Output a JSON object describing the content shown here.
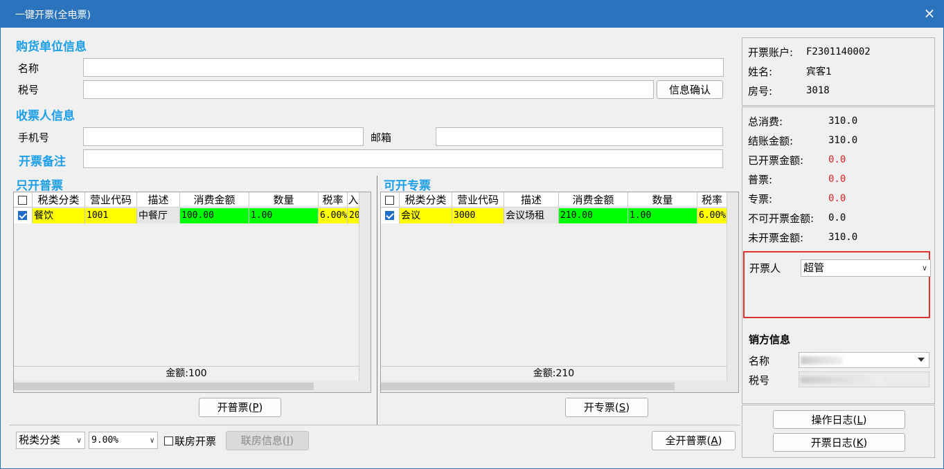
{
  "window": {
    "title": "一键开票(全电票)",
    "close_glyph": "×"
  },
  "buyer": {
    "section_title": "购货单位信息",
    "name_label": "名称",
    "name_value": "",
    "tax_label": "税号",
    "tax_value": "",
    "confirm_button": "信息确认"
  },
  "receiver": {
    "section_title": "收票人信息",
    "phone_label": "手机号",
    "phone_value": "",
    "email_label": "邮箱",
    "email_value": ""
  },
  "remark": {
    "label": "开票备注",
    "value": ""
  },
  "normal_grid": {
    "section_title": "只开普票",
    "columns": [
      "税类分类",
      "营业代码",
      "描述",
      "消费金额",
      "数量",
      "税率",
      "入"
    ],
    "rows": [
      {
        "checked": true,
        "category": "餐饮",
        "code": "1001",
        "desc": "中餐厅",
        "amount": "100.00",
        "qty": "1.00",
        "rate": "6.00%",
        "extra": "20"
      }
    ],
    "total": "金额:100",
    "issue_button": "开普票(P)",
    "issue_button_main": "开普票(",
    "issue_button_key": "P",
    "issue_button_end": ")"
  },
  "special_grid": {
    "section_title": "可开专票",
    "columns": [
      "税类分类",
      "营业代码",
      "描述",
      "消费金额",
      "数量",
      "税率"
    ],
    "rows": [
      {
        "checked": true,
        "category": "会议",
        "code": "3000",
        "desc": "会议场租",
        "amount": "210.00",
        "qty": "1.00",
        "rate": "6.00%"
      }
    ],
    "total": "金额:210",
    "issue_button": "开专票(S)",
    "issue_button_main": "开专票(",
    "issue_button_key": "S",
    "issue_button_end": ")"
  },
  "bottom": {
    "tax_category_select": "税类分类",
    "tax_rate_select": "9.00%",
    "joint_room_checkbox": "联房开票",
    "joint_room_checked": false,
    "joint_info_button_main": "联房信息(",
    "joint_info_button_key": "I",
    "joint_info_button_end": ")",
    "issue_all_button_main": "全开普票(",
    "issue_all_button_key": "A",
    "issue_all_button_end": ")"
  },
  "account": {
    "account_label": "开票账户:",
    "account_value": "F2301140002",
    "name_label": "姓名:",
    "name_value": "宾客1",
    "room_label": "房号:",
    "room_value": "3018"
  },
  "summary": {
    "items": [
      {
        "label": "总消费:",
        "value": "310.0",
        "color": "#000000"
      },
      {
        "label": "结账金额:",
        "value": "310.0",
        "color": "#000000"
      },
      {
        "label": "已开票金额:",
        "value": "0.0",
        "color": "#e02020"
      },
      {
        "label": "普票:",
        "value": "0.0",
        "color": "#e02020"
      },
      {
        "label": "专票:",
        "value": "0.0",
        "color": "#e02020"
      },
      {
        "label": "不可开票金额:",
        "value": "0.0",
        "color": "#000000"
      },
      {
        "label": "未开票金额:",
        "value": "310.0",
        "color": "#000000"
      }
    ]
  },
  "issuer": {
    "label": "开票人",
    "value": "超管",
    "highlight_color": "#e03030"
  },
  "seller": {
    "section_title": "销方信息",
    "name_label": "名称",
    "tax_label": "税号"
  },
  "logs": {
    "op_log_main": "操作日志(",
    "op_log_key": "L",
    "op_log_end": ")",
    "invoice_log_main": "开票日志(",
    "invoice_log_key": "K",
    "invoice_log_end": ")"
  }
}
